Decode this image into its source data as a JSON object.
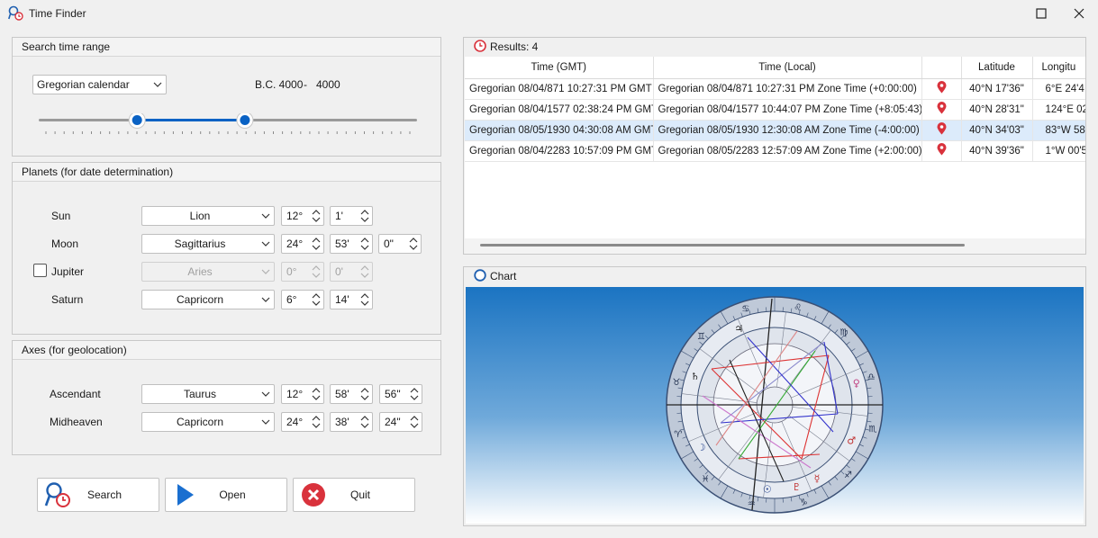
{
  "window": {
    "title": "Time Finder"
  },
  "search_range": {
    "title": "Search time range",
    "calendar": "Gregorian calendar",
    "range_from": "B.C. 4000",
    "range_sep": "-",
    "range_to": "4000",
    "slider_low_fraction": 0.26,
    "slider_high_fraction": 0.545
  },
  "planets": {
    "title": "Planets (for date determination)",
    "rows": [
      {
        "label": "Sun",
        "sign": "Lion",
        "deg": "12°",
        "min": "1'",
        "sec": null,
        "enabled": true,
        "has_checkbox": false
      },
      {
        "label": "Moon",
        "sign": "Sagittarius",
        "deg": "24°",
        "min": "53'",
        "sec": "0\"",
        "enabled": true,
        "has_checkbox": false
      },
      {
        "label": "Jupiter",
        "sign": "Aries",
        "deg": "0°",
        "min": "0'",
        "sec": null,
        "enabled": false,
        "has_checkbox": true,
        "checked": false
      },
      {
        "label": "Saturn",
        "sign": "Capricorn",
        "deg": "6°",
        "min": "14'",
        "sec": null,
        "enabled": true,
        "has_checkbox": false
      }
    ]
  },
  "axes": {
    "title": "Axes (for geolocation)",
    "rows": [
      {
        "label": "Ascendant",
        "sign": "Taurus",
        "deg": "12°",
        "min": "58'",
        "sec": "56\""
      },
      {
        "label": "Midheaven",
        "sign": "Capricorn",
        "deg": "24°",
        "min": "38'",
        "sec": "24\""
      }
    ]
  },
  "buttons": {
    "search": "Search",
    "open": "Open",
    "quit": "Quit"
  },
  "results": {
    "title": "Results: 4",
    "columns": [
      "Time (GMT)",
      "Time (Local)",
      "",
      "Latitude",
      "Longitu"
    ],
    "rows": [
      {
        "gmt": "Gregorian  08/04/871 10:27:31 PM GMT",
        "local": "Gregorian  08/04/871 10:27:31 PM  Zone Time (+0:00:00)",
        "lat": "40°N 17'36\"",
        "lon": "6°E 24'4",
        "selected": false
      },
      {
        "gmt": "Gregorian  08/04/1577 02:38:24 PM GMT",
        "local": "Gregorian  08/04/1577 10:44:07 PM  Zone Time (+8:05:43)",
        "lat": "40°N 28'31\"",
        "lon": "124°E 02'",
        "selected": false
      },
      {
        "gmt": "Gregorian  08/05/1930 04:30:08 AM GMT",
        "local": "Gregorian  08/05/1930 12:30:08 AM  Zone Time (-4:00:00)",
        "lat": "40°N 34'03\"",
        "lon": "83°W 58'",
        "selected": true
      },
      {
        "gmt": "Gregorian  08/04/2283 10:57:09 PM GMT",
        "local": "Gregorian  08/05/2283 12:57:09 AM  Zone Time (+2:00:00)",
        "lat": "40°N 39'36\"",
        "lon": "1°W 00'5",
        "selected": false
      }
    ]
  },
  "chart": {
    "title": "Chart"
  },
  "colors": {
    "accent": "#0a62c4",
    "pin": "#d9323c",
    "quit": "#d9323c",
    "sky_top": "#1b74c2",
    "sky_bottom": "#ffffff"
  }
}
